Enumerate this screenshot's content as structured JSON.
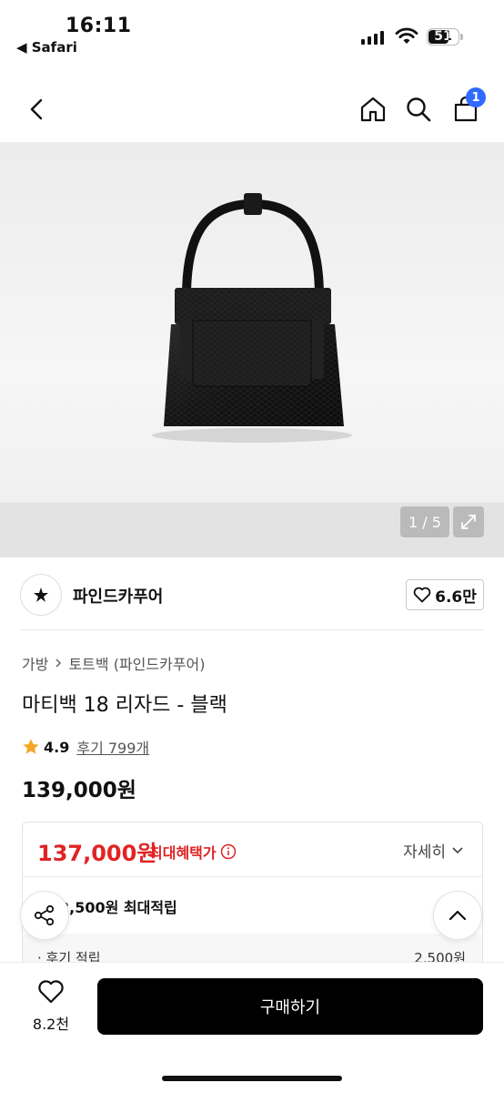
{
  "status_bar": {
    "time": "16:11",
    "back_app": "◀ Safari",
    "battery": "51"
  },
  "nav": {
    "back_icon": "chevron-left-icon",
    "home_icon": "home-icon",
    "search_icon": "search-icon",
    "cart_icon": "cart-icon",
    "cart_count": "1"
  },
  "gallery": {
    "counter": "1 / 5",
    "expand_icon": "expand-icon"
  },
  "brand": {
    "name": "파인드카푸어",
    "likes": "6.6만"
  },
  "breadcrumb": {
    "category": "가방",
    "subcategory": "토트백 (파인드카푸어)"
  },
  "product": {
    "title": "마티백 18 리자드 - 블랙",
    "rating": "4.9",
    "reviews": "후기 799개",
    "price": "139,000원"
  },
  "benefit": {
    "best_price": "137,000원",
    "best_label": "최대혜택가",
    "detail_label": "자세히",
    "points_text": "2,500원 최대적립",
    "review_point_label": "· 후기 적립",
    "review_point_amount": "2,500원"
  },
  "bottom_bar": {
    "wish_count": "8.2천",
    "buy_label": "구매하기"
  },
  "colors": {
    "accent_blue": "#2f6bff",
    "price_red": "#e02424",
    "star": "#f5a623"
  }
}
